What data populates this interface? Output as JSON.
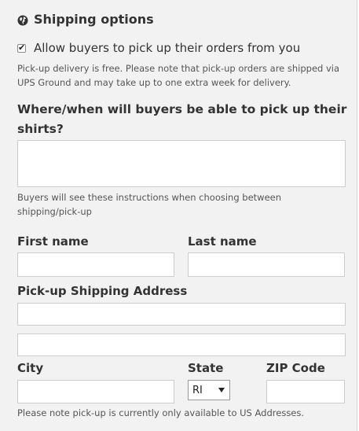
{
  "section": {
    "title": "Shipping options",
    "icon": "globe-icon"
  },
  "pickup": {
    "checkbox_checked": true,
    "checkbox_label": "Allow buyers to pick up their orders from you",
    "note": "Pick-up delivery is free. Please note that pick-up orders are shipped via UPS Ground and may take up to one extra week for delivery."
  },
  "instructions": {
    "question": "Where/when will buyers be able to pick up their shirts?",
    "value": "",
    "help": "Buyers will see these instructions when choosing between shipping/pick-up"
  },
  "address": {
    "first_name_label": "First name",
    "first_name_value": "",
    "last_name_label": "Last name",
    "last_name_value": "",
    "address_label": "Pick-up Shipping Address",
    "address_line1_value": "",
    "address_line2_value": "",
    "city_label": "City",
    "city_value": "",
    "state_label": "State",
    "state_value": "RI",
    "zip_label": "ZIP Code",
    "zip_value": "",
    "note": "Please note pick-up is currently only available to US Addresses."
  },
  "colors": {
    "panel_bg": "#f2f2f2",
    "text": "#333333",
    "field_border": "#cccccc"
  }
}
